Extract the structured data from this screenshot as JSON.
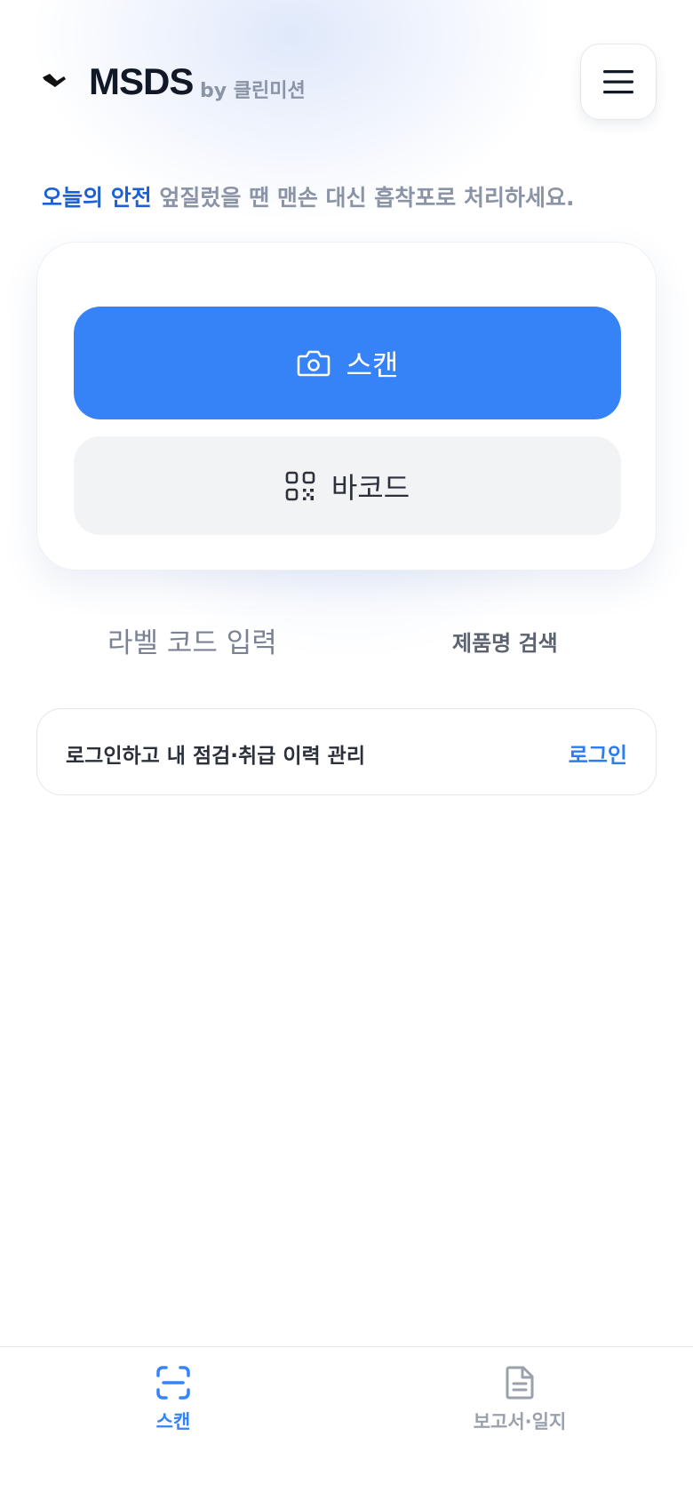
{
  "header": {
    "brand": "MSDS",
    "brand_sub": "by 클린미션",
    "logo_icon": "brand-logo-icon",
    "menu_icon": "hamburger-menu-icon"
  },
  "tip": {
    "label": "오늘의 안전",
    "text": " 엎질렀을 땐 맨손 대신 흡착포로 처리하세요."
  },
  "actions": {
    "scan_label": "스캔",
    "scan_icon": "camera-icon",
    "barcode_label": "바코드",
    "barcode_icon": "qr-code-icon"
  },
  "tabs": {
    "label_code_input": "라벨 코드 입력",
    "product_search": "제품명 검색"
  },
  "login_banner": {
    "text": "로그인하고 내 점검·취급 이력 관리",
    "link": "로그인"
  },
  "bottom_nav": {
    "items": [
      {
        "label": "스캔",
        "icon": "scan-frame-icon",
        "active": true
      },
      {
        "label": "보고서·일지",
        "icon": "document-icon",
        "active": false
      }
    ]
  },
  "colors": {
    "accent": "#3583f6",
    "tip_label": "#1d5fd6",
    "muted": "#8a94a6"
  }
}
